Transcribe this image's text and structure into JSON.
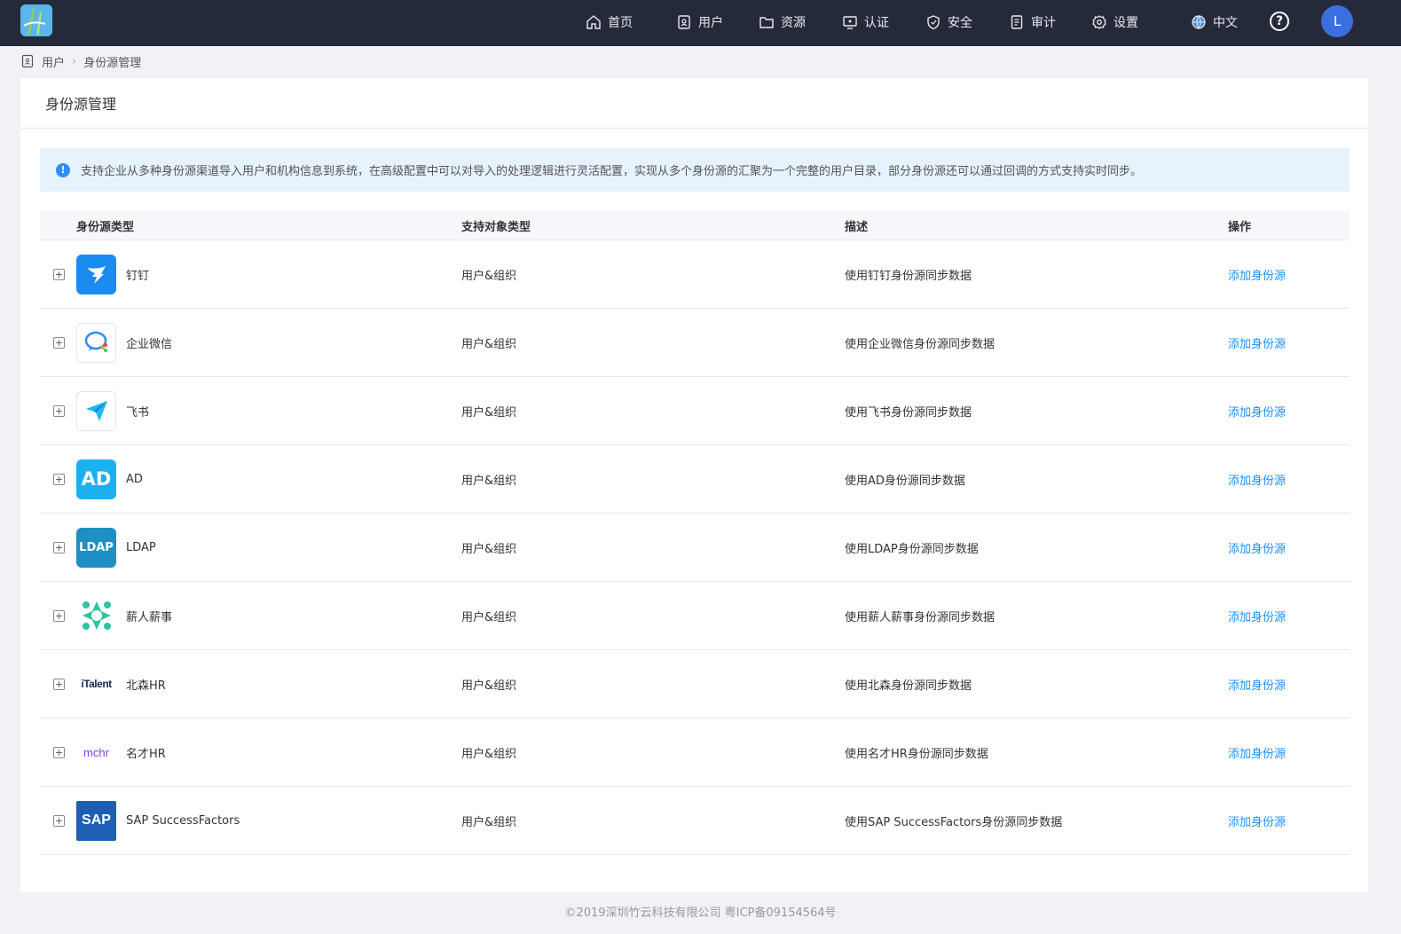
{
  "nav": {
    "items": [
      {
        "label": "首页",
        "icon": "home-icon"
      },
      {
        "label": "用户",
        "icon": "user-icon"
      },
      {
        "label": "资源",
        "icon": "folder-icon"
      },
      {
        "label": "认证",
        "icon": "monitor-icon"
      },
      {
        "label": "安全",
        "icon": "shield-icon"
      },
      {
        "label": "审计",
        "icon": "audit-icon"
      },
      {
        "label": "设置",
        "icon": "gear-icon"
      }
    ],
    "language": "中文",
    "help": "?",
    "avatar": "L"
  },
  "breadcrumb": {
    "parent": "用户",
    "current": "身份源管理"
  },
  "page": {
    "title": "身份源管理",
    "alert": "支持企业从多种身份源渠道导入用户和机构信息到系统，在高级配置中可以对导入的处理逻辑进行灵活配置，实现从多个身份源的汇聚为一个完整的用户目录，部分身份源还可以通过回调的方式支持实时同步。"
  },
  "table": {
    "columns": [
      "身份源类型",
      "支持对象类型",
      "描述",
      "操作"
    ],
    "rows": [
      {
        "name": "钉钉",
        "type": "用户&组织",
        "desc": "使用钉钉身份源同步数据",
        "action": "添加身份源",
        "icon": "dingtalk-icon",
        "icon_text": ""
      },
      {
        "name": "企业微信",
        "type": "用户&组织",
        "desc": "使用企业微信身份源同步数据",
        "action": "添加身份源",
        "icon": "wework-icon",
        "icon_text": ""
      },
      {
        "name": "飞书",
        "type": "用户&组织",
        "desc": "使用飞书身份源同步数据",
        "action": "添加身份源",
        "icon": "feishu-icon",
        "icon_text": ""
      },
      {
        "name": "AD",
        "type": "用户&组织",
        "desc": "使用AD身份源同步数据",
        "action": "添加身份源",
        "icon": "ad-icon",
        "icon_text": "AD"
      },
      {
        "name": "LDAP",
        "type": "用户&组织",
        "desc": "使用LDAP身份源同步数据",
        "action": "添加身份源",
        "icon": "ldap-icon",
        "icon_text": "LDAP"
      },
      {
        "name": "薪人薪事",
        "type": "用户&组织",
        "desc": "使用薪人薪事身份源同步数据",
        "action": "添加身份源",
        "icon": "xinrenxinshi-icon",
        "icon_text": ""
      },
      {
        "name": "北森HR",
        "type": "用户&组织",
        "desc": "使用北森身份源同步数据",
        "action": "添加身份源",
        "icon": "italent-icon",
        "icon_text": "iTalent"
      },
      {
        "name": "名才HR",
        "type": "用户&组织",
        "desc": "使用名才HR身份源同步数据",
        "action": "添加身份源",
        "icon": "mchr-icon",
        "icon_text": "mchr"
      },
      {
        "name": "SAP SuccessFactors",
        "type": "用户&组织",
        "desc": "使用SAP SuccessFactors身份源同步数据",
        "action": "添加身份源",
        "icon": "sap-icon",
        "icon_text": "SAP"
      }
    ]
  },
  "footer": "©2019深圳竹云科技有限公司 粤ICP备09154564号"
}
